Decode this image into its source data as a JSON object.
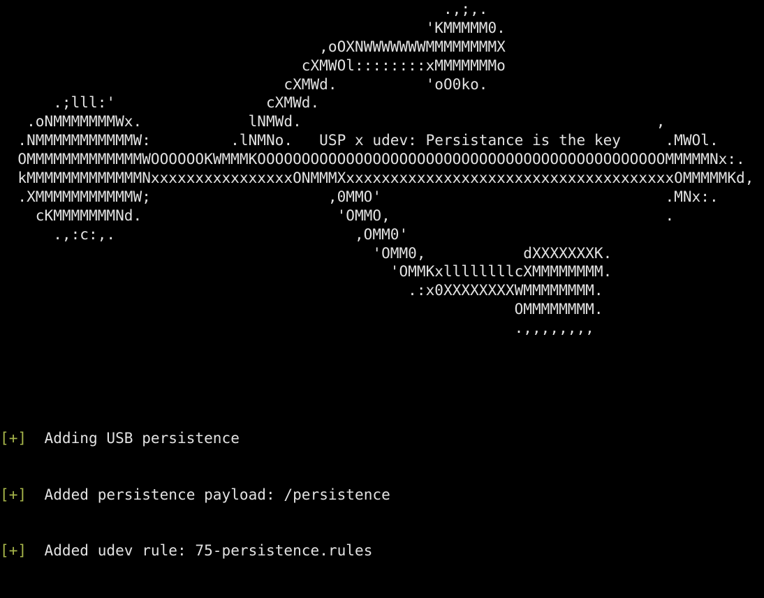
{
  "terminal": {
    "colors": {
      "background": "#000000",
      "text": "#e2e2e2",
      "prefix": "#a6b54a"
    },
    "banner": [
      "                                                  .,;,.",
      "                                                'KMMMMM0.",
      "                                    ,oOXNWWWWWWWMMMMMMMMX",
      "                                  cXMWOl::::::::xMMMMMMMo",
      "                                cXMWd.          'oO0ko.",
      "      .;lll:'                 cXMWd.",
      "   .oNMMMMMMMWx.            lNMWd.                                        ,",
      "  .NMMMMMMMMMMMW:         .lNMNo.   USP x udev: Persistance is the key     .MWOl.",
      "  OMMMMMMMMMMMMMWOOOOOOKWMMMKOOOOOOOOOOOOOOOOOOOOOOOOOOOOOOOOOOOOOOOOOOOOOOMMMMMNx:.",
      "  kMMMMMMMMMMMMMNxxxxxxxxxxxxxxxxONMMMXxxxxxxxxxxxxxxxxxxxxxxxxxxxxxxxxxxxxxOMMMMMKd,",
      "  .XMMMMMMMMMMMW;                    ,0MMO'                                .MNx:.",
      "    cKMMMMMMMNd.                      'OMMO,                               .",
      "      .,:c:,.                           ,OMM0'",
      "                                          'OMM0,           dXXXXXXXK.",
      "                                            'OMMKxllllllllcXMMMMMMMM.",
      "                                              .:x0XXXXXXXXWMMMMMMMM.",
      "                                                          OMMMMMMMM.",
      "                                                          .,,,,,,,,"
    ],
    "log": [
      {
        "prefix": "[+]",
        "message": "  Adding USB persistence"
      },
      {
        "prefix": "[+]",
        "message": "  Added persistence payload: /persistence"
      },
      {
        "prefix": "[+]",
        "message": "  Added udev rule: 75-persistence.rules"
      }
    ]
  }
}
